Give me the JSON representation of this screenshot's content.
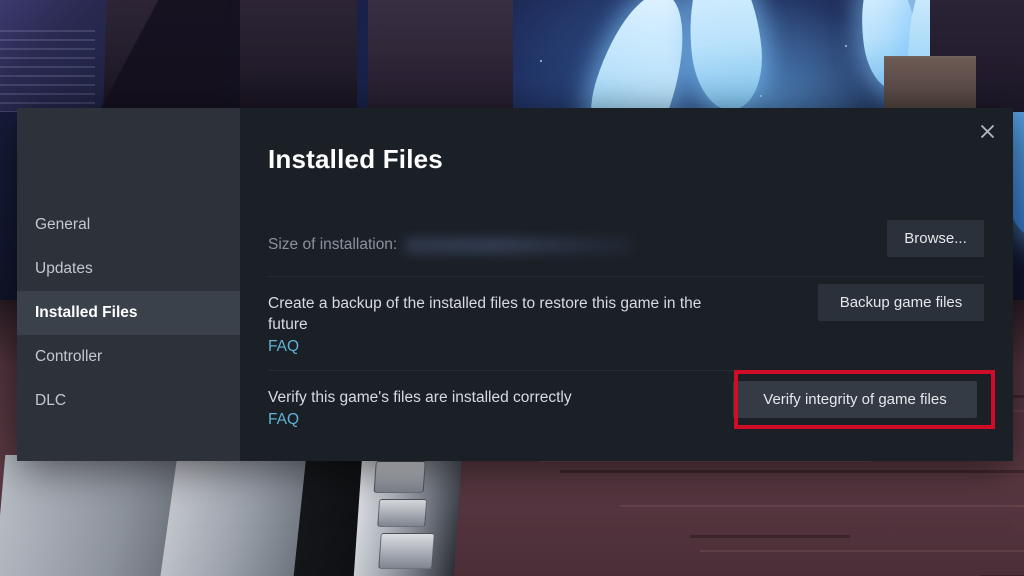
{
  "modal": {
    "title": "Installed Files",
    "close_icon": "close-icon",
    "sidebar": {
      "items": [
        {
          "label": "General",
          "active": false
        },
        {
          "label": "Updates",
          "active": false
        },
        {
          "label": "Installed Files",
          "active": true
        },
        {
          "label": "Controller",
          "active": false
        },
        {
          "label": "DLC",
          "active": false
        }
      ]
    },
    "rows": [
      {
        "id": "size-of-installation",
        "label": "Size of installation:",
        "value": "",
        "value_redacted": true,
        "button": "Browse...",
        "faq": null
      },
      {
        "id": "backup-game-files",
        "label": "Create a backup of the installed files to restore this game in the future",
        "faq": "FAQ",
        "button": "Backup game files"
      },
      {
        "id": "verify-integrity",
        "label": "Verify this game's files are installed correctly",
        "faq": "FAQ",
        "button": "Verify integrity of game files",
        "highlighted": true
      }
    ]
  },
  "colors": {
    "highlight": "#cf0d26",
    "link": "#5fb2d6",
    "panel": "#1b2027",
    "sidebar": "#2d3139",
    "sidebar_active": "#3b414b",
    "button": "#2b313a"
  }
}
